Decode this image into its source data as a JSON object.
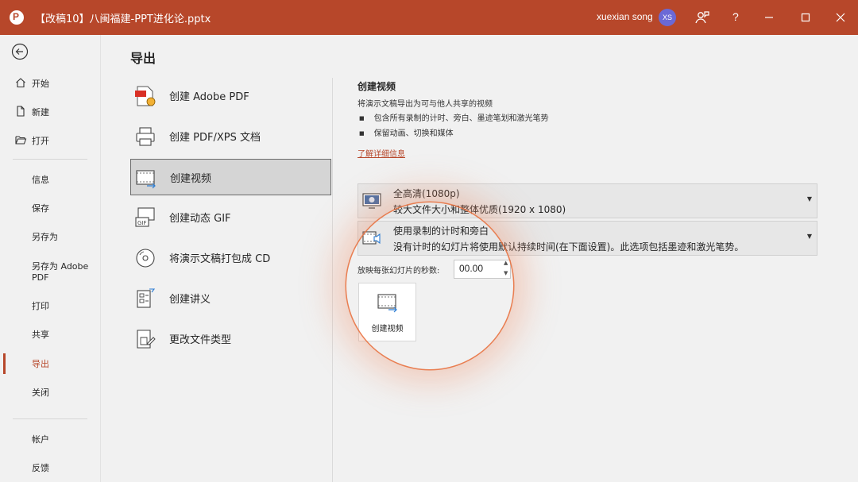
{
  "titlebar": {
    "doc_title": "【改稿10】八闽福建-PPT进化论.pptx",
    "user_name": "xuexian song",
    "avatar_initials": "XS",
    "help_glyph": "?"
  },
  "colors": {
    "accent": "#b7472a",
    "avatar": "#6b69d6",
    "spotlight": "#e86e3c"
  },
  "nav": {
    "top_items": [
      {
        "label": "开始",
        "icon": "home-icon"
      },
      {
        "label": "新建",
        "icon": "new-document-icon"
      },
      {
        "label": "打开",
        "icon": "folder-open-icon"
      }
    ],
    "mid_items": [
      "信息",
      "保存",
      "另存为",
      "另存为 Adobe PDF",
      "打印",
      "共享",
      "导出",
      "关闭"
    ],
    "active": "导出",
    "bottom_items": [
      "帐户",
      "反馈"
    ]
  },
  "main": {
    "title": "导出",
    "export_options": [
      {
        "label": "创建 Adobe PDF",
        "icon": "adobe-pdf-icon"
      },
      {
        "label": "创建 PDF/XPS 文档",
        "icon": "printer-icon"
      },
      {
        "label": "创建视频",
        "icon": "video-icon"
      },
      {
        "label": "创建动态 GIF",
        "icon": "gif-icon"
      },
      {
        "label": "将演示文稿打包成 CD",
        "icon": "cd-icon"
      },
      {
        "label": "创建讲义",
        "icon": "handout-icon"
      },
      {
        "label": "更改文件类型",
        "icon": "file-type-icon"
      }
    ],
    "selected": "创建视频"
  },
  "detail": {
    "title": "创建视频",
    "description": "将演示文稿导出为可与他人共享的视频",
    "bullets": [
      "包含所有录制的计时、旁白、墨迹笔划和激光笔势",
      "保留动画、切换和媒体"
    ],
    "learn_more": "了解详细信息",
    "quality": {
      "main": "全高清(1080p)",
      "sub": "较大文件大小和整体优质(1920 x 1080)"
    },
    "timing": {
      "main": "使用录制的计时和旁白",
      "sub": "没有计时的幻灯片将使用默认持续时间(在下面设置)。此选项包括墨迹和激光笔势。"
    },
    "seconds_label": "放映每张幻灯片的秒数:",
    "seconds_value": "00.00",
    "create_button": "创建视频"
  }
}
